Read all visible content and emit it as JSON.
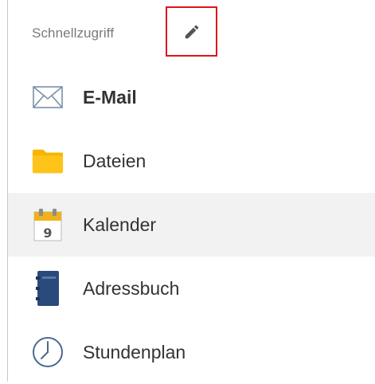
{
  "quick_access": {
    "title": "Schnellzugriff",
    "items": [
      {
        "label": "E-Mail",
        "icon": "envelope-icon",
        "bold": true,
        "active": false
      },
      {
        "label": "Dateien",
        "icon": "folder-icon",
        "bold": false,
        "active": false
      },
      {
        "label": "Kalender",
        "icon": "calendar-icon",
        "bold": false,
        "active": true,
        "calendar_day": "9"
      },
      {
        "label": "Adressbuch",
        "icon": "address-book-icon",
        "bold": false,
        "active": false
      },
      {
        "label": "Stundenplan",
        "icon": "clock-icon",
        "bold": false,
        "active": false
      }
    ]
  },
  "colors": {
    "highlight_border": "#e0131b",
    "folder": "#f7b500",
    "calendar": "#f0b21a",
    "address_book": "#2a4a7b",
    "clock": "#4a6a8f",
    "envelope": "#7a8fa8"
  }
}
